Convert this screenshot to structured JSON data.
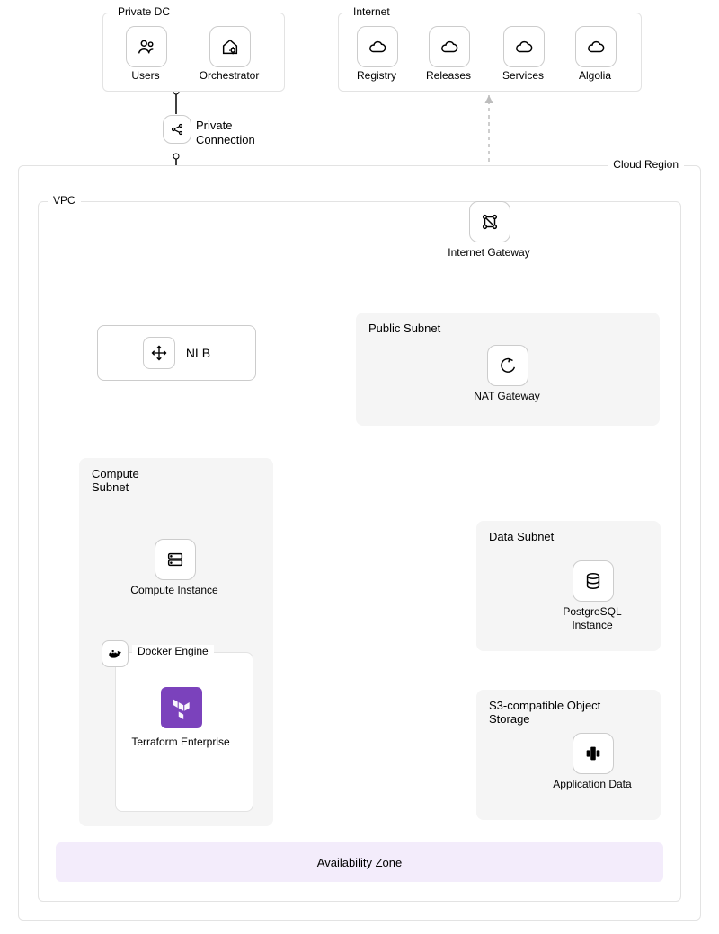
{
  "groups": {
    "private_dc": "Private DC",
    "internet": "Internet",
    "cloud_region": "Cloud Region",
    "vpc": "VPC",
    "public_subnet": "Public Subnet",
    "compute_subnet": "Compute Subnet",
    "data_subnet": "Data Subnet",
    "s3_subnet": "S3-compatible Object Storage",
    "docker_engine": "Docker Engine",
    "availability_zone": "Availability Zone"
  },
  "nodes": {
    "users": "Users",
    "orchestrator": "Orchestrator",
    "registry": "Registry",
    "releases": "Releases",
    "services": "Services",
    "algolia": "Algolia",
    "private_connection": "Private Connection",
    "nlb": "NLB",
    "internet_gateway": "Internet Gateway",
    "nat_gateway": "NAT Gateway",
    "compute_instance": "Compute Instance",
    "terraform_enterprise": "Terraform Enterprise",
    "postgresql_instance": "PostgreSQL Instance",
    "application_data": "Application Data"
  },
  "colors": {
    "subnet_bg": "#f5f5f5",
    "az_bg": "#f3ecfb",
    "terraform": "#7b42bc",
    "border": "#e3e3e3",
    "node_border": "#cccccc"
  }
}
